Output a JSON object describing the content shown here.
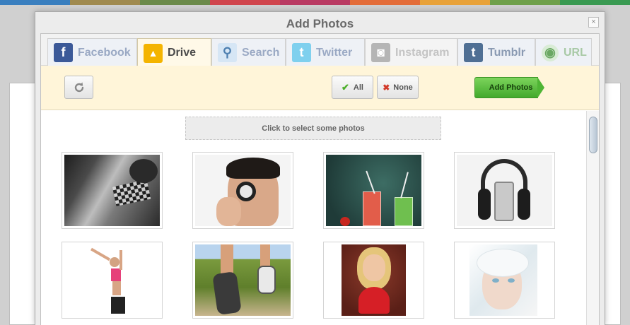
{
  "top_stripe_colors": [
    "#3a7fbf",
    "#a08a4f",
    "#6b8a4a",
    "#d0464d",
    "#b93b63",
    "#e36d3a",
    "#e8a23a",
    "#6fa04a",
    "#3a9a52"
  ],
  "dialog": {
    "title": "Add Photos",
    "close_label": "×"
  },
  "tabs": [
    {
      "label": "Facebook",
      "icon": "facebook-icon",
      "glyph": "f",
      "color": "#3b5998"
    },
    {
      "label": "Drive",
      "icon": "google-drive-icon",
      "glyph": "▲",
      "color": "#f4b400"
    },
    {
      "label": "Search",
      "icon": "search-icon",
      "glyph": "⚲",
      "color": "#d6e6f5"
    },
    {
      "label": "Twitter",
      "icon": "twitter-icon",
      "glyph": "t",
      "color": "#7fd0ee"
    },
    {
      "label": "Instagram",
      "icon": "instagram-icon",
      "glyph": "◙",
      "color": "#b5b5b5"
    },
    {
      "label": "Tumblr",
      "icon": "tumblr-icon",
      "glyph": "t",
      "color": "#4f6f94"
    },
    {
      "label": "URL",
      "icon": "url-icon",
      "glyph": "◉",
      "color": "#8cc084"
    }
  ],
  "active_tab": "Drive",
  "toolbar": {
    "refresh_icon": "refresh-icon",
    "all_label": "All",
    "none_label": "None",
    "add_label": "Add Photos"
  },
  "content": {
    "select_prompt": "Click to select some photos"
  },
  "photos": [
    {
      "name": "photo-body-paint",
      "bg": "#8a8a8a"
    },
    {
      "name": "photo-doctor-stethoscope",
      "bg": "#d9d9d9"
    },
    {
      "name": "photo-smoothies",
      "bg": "#2a4a45"
    },
    {
      "name": "photo-headphones-phone",
      "bg": "#eeeeee"
    },
    {
      "name": "photo-dancing-woman",
      "bg": "#ffffff"
    },
    {
      "name": "photo-running-shoes",
      "bg": "#6a8b3b"
    },
    {
      "name": "photo-woman-heart",
      "bg": "#6b2a1f"
    },
    {
      "name": "photo-snow-woman",
      "bg": "#e6ecef"
    }
  ]
}
